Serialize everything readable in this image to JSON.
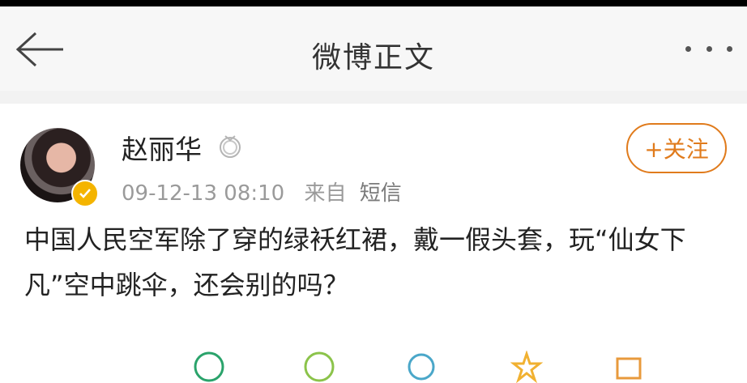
{
  "header": {
    "title": "微博正文"
  },
  "post": {
    "author": "赵丽华",
    "timestamp": "09-12-13 08:10",
    "source_prefix": "来自",
    "source_app": "短信",
    "follow_label": "+关注",
    "content": "中国人民空军除了穿的绿袄红裙，戴一假头套，玩“仙女下凡”空中跳伞，还会别的吗？"
  },
  "icons": {
    "back": "back-arrow-icon",
    "more": "more-dots-icon",
    "verified": "verified-badge-icon",
    "medal": "medal-icon"
  },
  "colors": {
    "accent": "#e07b1c",
    "verified": "#f4b400",
    "meta_text": "#9a9a9a"
  }
}
